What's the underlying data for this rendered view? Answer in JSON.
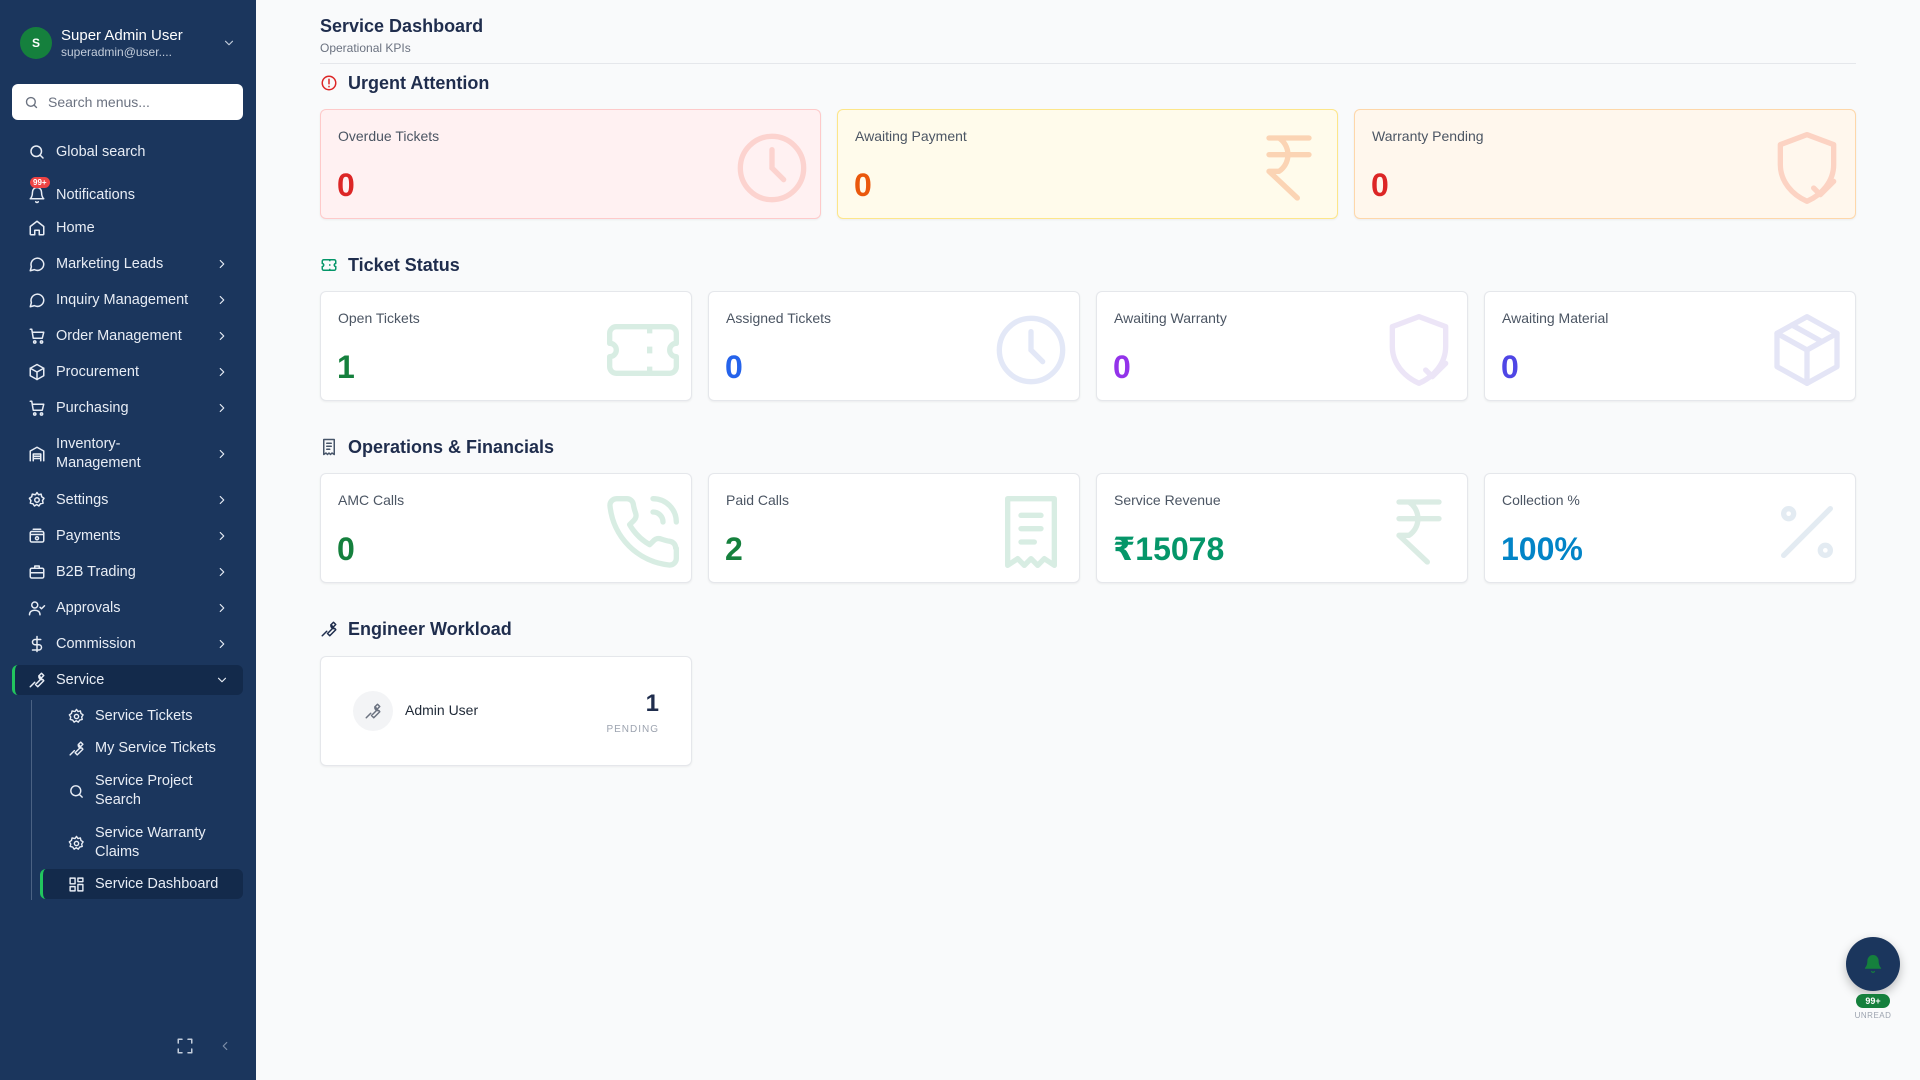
{
  "user": {
    "initial": "S",
    "name": "Super Admin User",
    "email": "superadmin@user...."
  },
  "search": {
    "placeholder": "Search menus..."
  },
  "nav": {
    "global_search": "Global search",
    "notifications": "Notifications",
    "notifications_badge": "99+",
    "home": "Home",
    "marketing_leads": "Marketing Leads",
    "inquiry_management": "Inquiry Management",
    "order_management": "Order Management",
    "procurement": "Procurement",
    "purchasing": "Purchasing",
    "inventory_line1": "Inventory-",
    "inventory_line2": "Management",
    "settings": "Settings",
    "payments": "Payments",
    "b2b_trading": "B2B Trading",
    "approvals": "Approvals",
    "commission": "Commission",
    "service": "Service",
    "service_sub": {
      "tickets": "Service Tickets",
      "my_tickets": "My Service Tickets",
      "project_search_1": "Service Project",
      "project_search_2": "Search",
      "warranty_1": "Service Warranty",
      "warranty_2": "Claims",
      "dashboard": "Service Dashboard"
    }
  },
  "page": {
    "title": "Service Dashboard",
    "subtitle": "Operational KPIs"
  },
  "sections": {
    "urgent": "Urgent Attention",
    "ticket_status": "Ticket Status",
    "operations": "Operations & Financials",
    "engineer": "Engineer Workload"
  },
  "urgent_cards": [
    {
      "label": "Overdue Tickets",
      "value": "0"
    },
    {
      "label": "Awaiting Payment",
      "value": "0"
    },
    {
      "label": "Warranty Pending",
      "value": "0"
    }
  ],
  "ticket_cards": [
    {
      "label": "Open Tickets",
      "value": "1"
    },
    {
      "label": "Assigned Tickets",
      "value": "0"
    },
    {
      "label": "Awaiting Warranty",
      "value": "0"
    },
    {
      "label": "Awaiting Material",
      "value": "0"
    }
  ],
  "ops_cards": [
    {
      "label": "AMC Calls",
      "value": "0"
    },
    {
      "label": "Paid Calls",
      "value": "2"
    },
    {
      "label": "Service Revenue",
      "value": "₹15078"
    },
    {
      "label": "Collection %",
      "value": "100%"
    }
  ],
  "workload": [
    {
      "name": "Admin User",
      "count": "1",
      "status": "PENDING"
    }
  ],
  "fab": {
    "badge": "99+",
    "label": "UNREAD"
  },
  "colors": {
    "sidebar": "#1b365d",
    "accent_green": "#22c55e",
    "red": "#dc2626",
    "orange": "#ea580c",
    "green": "#15803d",
    "blue": "#2563eb",
    "purple": "#9333ea",
    "indigo": "#4f46e5",
    "teal": "#059669",
    "sky": "#0284c7"
  }
}
